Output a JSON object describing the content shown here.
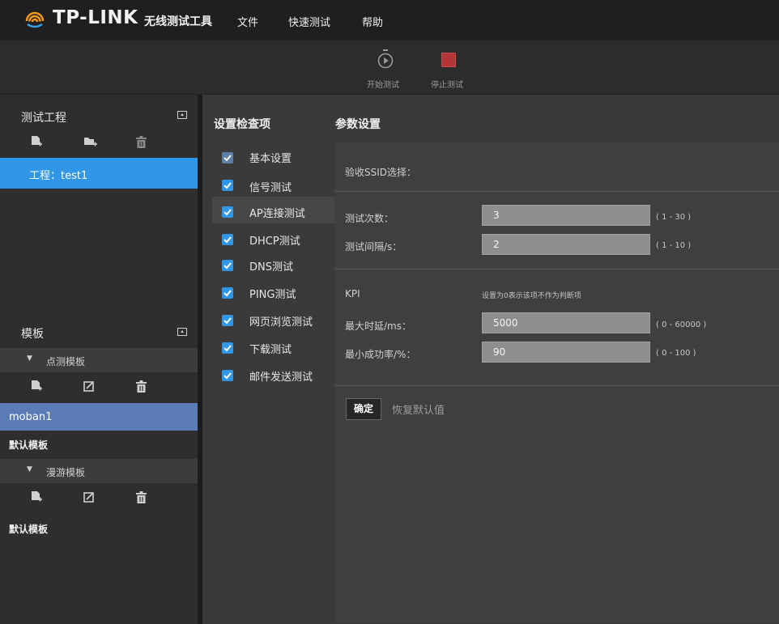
{
  "app": {
    "brand": "TP-LINK",
    "subtitle": "无线测试工具",
    "menu": [
      "文件",
      "快速测试",
      "帮助"
    ]
  },
  "toolbar": {
    "start_label": "开始测试",
    "stop_label": "停止测试"
  },
  "sidebar": {
    "projects": {
      "title": "测试工程",
      "items": [
        "工程：test1"
      ]
    },
    "templates": {
      "title": "模板",
      "groups": [
        {
          "name": "点测模板",
          "items": [
            "moban1",
            "默认模板"
          ]
        },
        {
          "name": "漫游模板",
          "items": [
            "默认模板"
          ]
        }
      ]
    }
  },
  "checklist": {
    "title": "设置检查项",
    "items": [
      {
        "label": "基本设置",
        "checked": true
      },
      {
        "label": "信号测试",
        "checked": true
      },
      {
        "label": "AP连接测试",
        "checked": true,
        "active": true
      },
      {
        "label": "DHCP测试",
        "checked": true
      },
      {
        "label": "DNS测试",
        "checked": true
      },
      {
        "label": "PING测试",
        "checked": true
      },
      {
        "label": "网页浏览测试",
        "checked": true
      },
      {
        "label": "下载测试",
        "checked": true
      },
      {
        "label": "邮件发送测试",
        "checked": true
      }
    ]
  },
  "params": {
    "title": "参数设置",
    "ssid_label": "验收SSID选择：",
    "fields": [
      {
        "label": "测试次数：",
        "value": "3",
        "range": "( 1 - 30 )"
      },
      {
        "label": "测试间隔/s：",
        "value": "2",
        "range": "( 1 - 10 )"
      }
    ],
    "kpi_label": "KPI",
    "kpi_note": "设置为0表示该项不作为判断项",
    "kpi_fields": [
      {
        "label": "最大时延/ms：",
        "value": "5000",
        "range": "( 0 - 60000 )"
      },
      {
        "label": "最小成功率/%：",
        "value": "90",
        "range": "( 0 - 100 )"
      }
    ],
    "confirm_label": "确定",
    "restore_label": "恢复默认值"
  },
  "colors": {
    "accent_blue": "#2f96e8",
    "selected_template": "#5b7cb8",
    "stop_red": "#b33636"
  }
}
